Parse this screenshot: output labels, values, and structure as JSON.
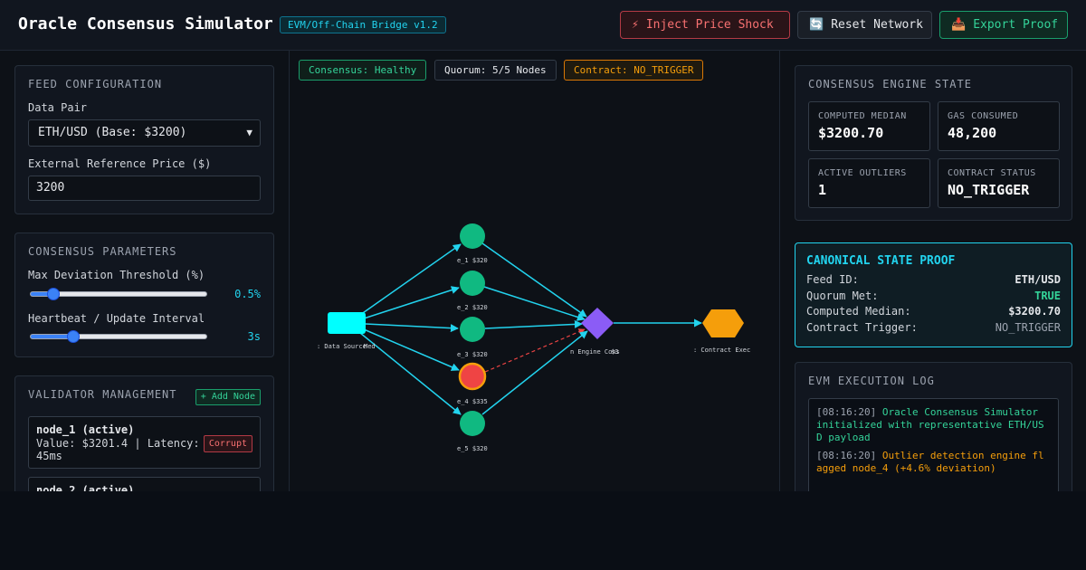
{
  "header": {
    "title": "Oracle Consensus Simulator",
    "badge": "EVM/Off-Chain Bridge v1.2",
    "buttons": {
      "shock": "Inject Price Shock",
      "reset": "Reset Network",
      "export": "Export Proof"
    },
    "icons": {
      "shock": "lightning-icon",
      "reset": "refresh-icon",
      "export": "inbox-tray-icon"
    }
  },
  "feed": {
    "title": "FEED CONFIGURATION",
    "pair_label": "Data Pair",
    "pair_value": "ETH/USD (Base: $3200)",
    "ref_label": "External Reference Price ($)",
    "ref_value": "3200"
  },
  "params": {
    "title": "CONSENSUS PARAMETERS",
    "deviation_label": "Max Deviation Threshold (%)",
    "deviation_value": "0.5%",
    "deviation_level": 0.1,
    "heartbeat_label": "Heartbeat / Update Interval",
    "heartbeat_value": "3s",
    "heartbeat_level": 0.22
  },
  "validators": {
    "title": "VALIDATOR MANAGEMENT",
    "add_label": "+ Add Node",
    "items": [
      {
        "name": "node_1 (active)",
        "info": "Value: $3201.4 | Latency: 45ms",
        "action": "Corrupt"
      },
      {
        "name": "node_2 (active)",
        "info": "",
        "action": ""
      }
    ]
  },
  "status": {
    "consensus": "Consensus: Healthy",
    "quorum": "Quorum: 5/5 Nodes",
    "contract": "Contract: NO_TRIGGER"
  },
  "graph": {
    "source_label": ": Data Source",
    "source_sub": "Med",
    "nodes": [
      {
        "label": "e_1 $320",
        "color": "#10b981",
        "outlier": false
      },
      {
        "label": "e_2 $320",
        "color": "#10b981",
        "outlier": false
      },
      {
        "label": "e_3 $320",
        "color": "#10b981",
        "outlier": false
      },
      {
        "label": "e_4 $335",
        "color": "#ef4444",
        "outlier": true
      },
      {
        "label": "e_5 $320",
        "color": "#10b981",
        "outlier": false
      }
    ],
    "engine_label": "n Engine Cons",
    "engine_sub": "$3",
    "contract_label": ": Contract Exec",
    "contract_sub": "",
    "colors": {
      "source": "#00ffff",
      "engine": "#8b5cf6",
      "contract": "#f59e0b",
      "edge": "#22d3ee",
      "outlier_edge": "#ef4444"
    }
  },
  "engine": {
    "title": "CONSENSUS ENGINE STATE",
    "median_label": "COMPUTED MEDIAN",
    "median_value": "$3200.70",
    "gas_label": "GAS CONSUMED",
    "gas_value": "48,200",
    "outliers_label": "ACTIVE OUTLIERS",
    "outliers_value": "1",
    "status_label": "CONTRACT STATUS",
    "status_value": "NO_TRIGGER"
  },
  "proof": {
    "title": "CANONICAL STATE PROOF",
    "rows": [
      {
        "k": "Feed ID:",
        "v": "ETH/USD"
      },
      {
        "k": "Quorum Met:",
        "v": "TRUE"
      },
      {
        "k": "Computed Median:",
        "v": "$3200.70"
      },
      {
        "k": "Contract Trigger:",
        "v": "NO_TRIGGER"
      }
    ]
  },
  "log": {
    "title": "EVM EXECUTION LOG",
    "entries": [
      {
        "ts": "[08:16:20]",
        "msg": "Oracle Consensus Simulator initialized with representative ETH/USD payload",
        "level": "info"
      },
      {
        "ts": "[08:16:20]",
        "msg": "Outlier detection engine flagged node_4 (+4.6% deviation)",
        "level": "warn"
      }
    ]
  }
}
